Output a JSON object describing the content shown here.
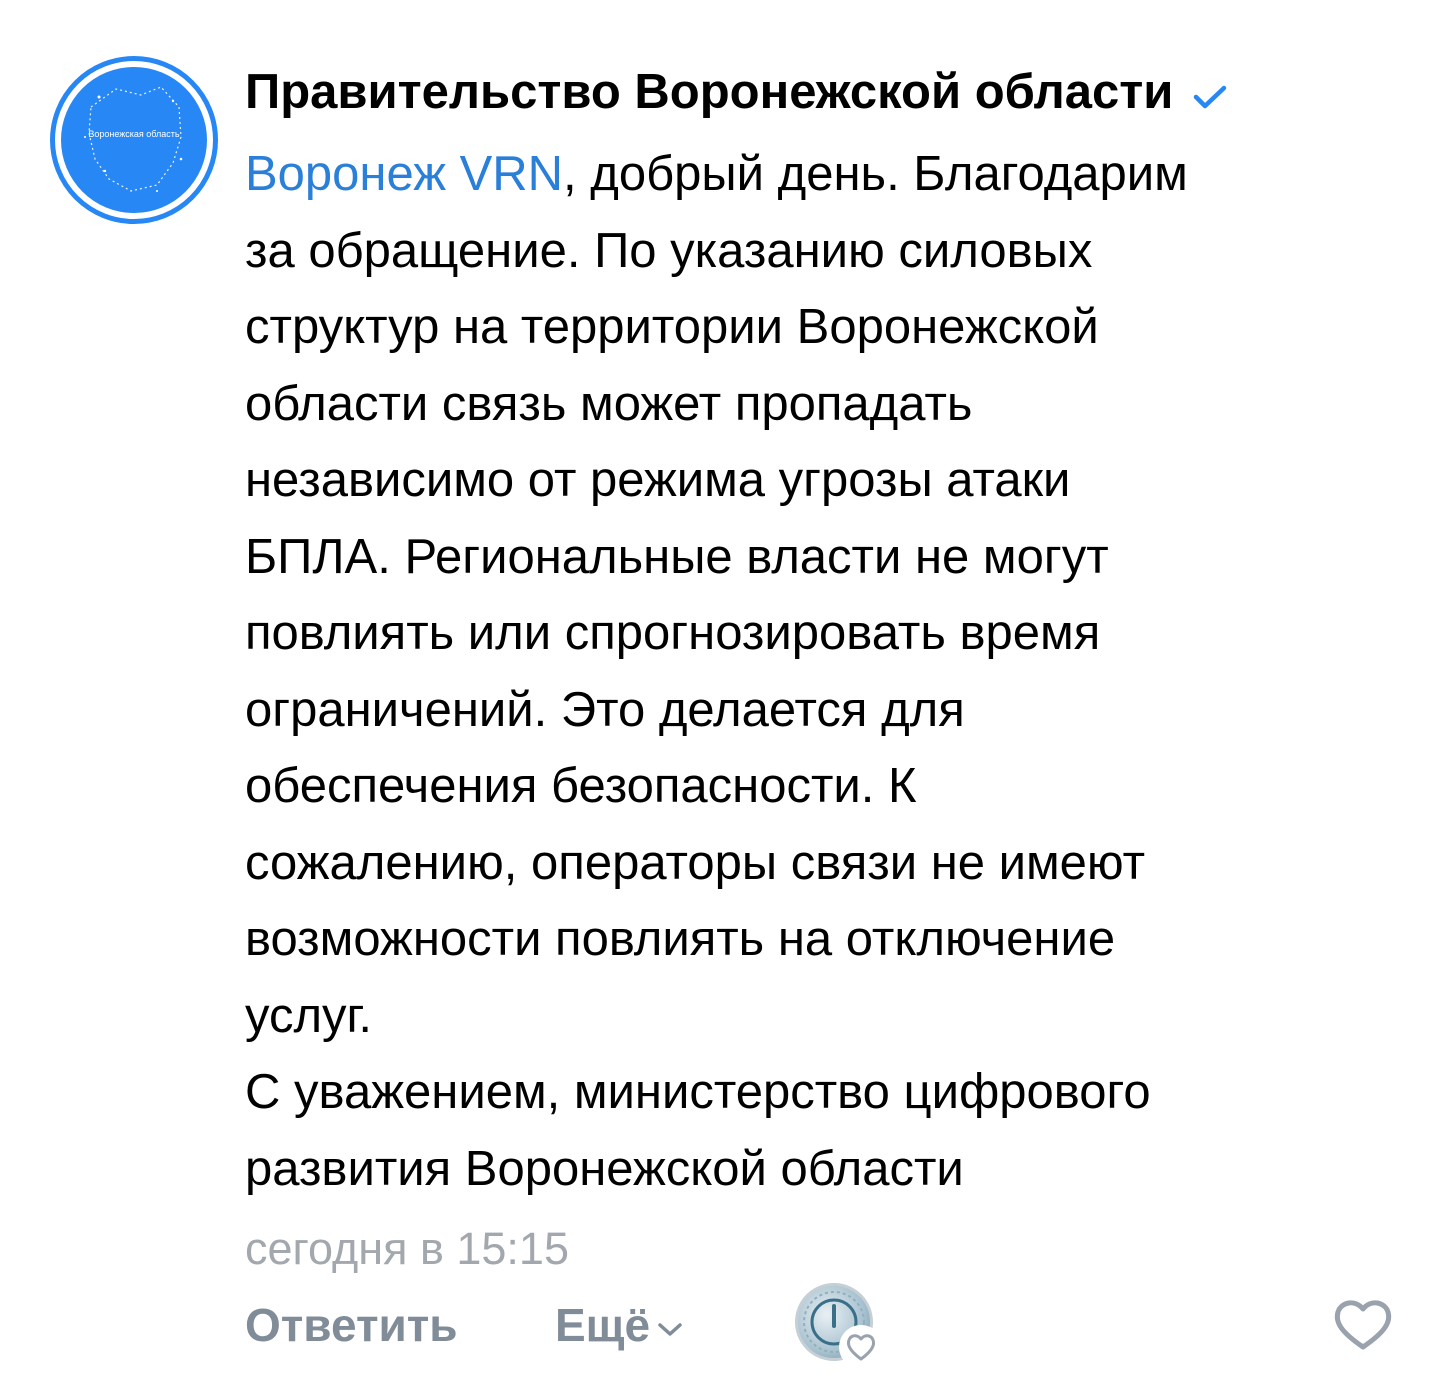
{
  "comment": {
    "author": "Правительство Воронежской области",
    "avatar_text": "Воронежская область",
    "verified_icon": "checkmark-icon",
    "mention": "Воронеж VRN",
    "body_lines": [
      ", добрый день. Благодарим",
      "за обращение. По указанию силовых",
      "структур на территории Воронежской",
      "области связь может пропадать",
      "независимо от режима угрозы атаки",
      "БПЛА. Региональные власти не могут",
      "повлиять или спрогнозировать время",
      "ограничений. Это делается для",
      "обеспечения безопасности. К",
      "сожалению, операторы связи не имеют",
      "возможности повлиять на отключение",
      "услуг.",
      "С уважением, министерство цифрового",
      "развития Воронежской области"
    ],
    "timestamp": "сегодня в 15:15"
  },
  "actions": {
    "reply_label": "Ответить",
    "more_label": "Ещё",
    "like_icon": "heart-outline-icon"
  },
  "colors": {
    "accent": "#2787f5",
    "mention": "#2a7fd9",
    "secondary_text": "#818c99",
    "timestamp": "#a3a8ae"
  }
}
